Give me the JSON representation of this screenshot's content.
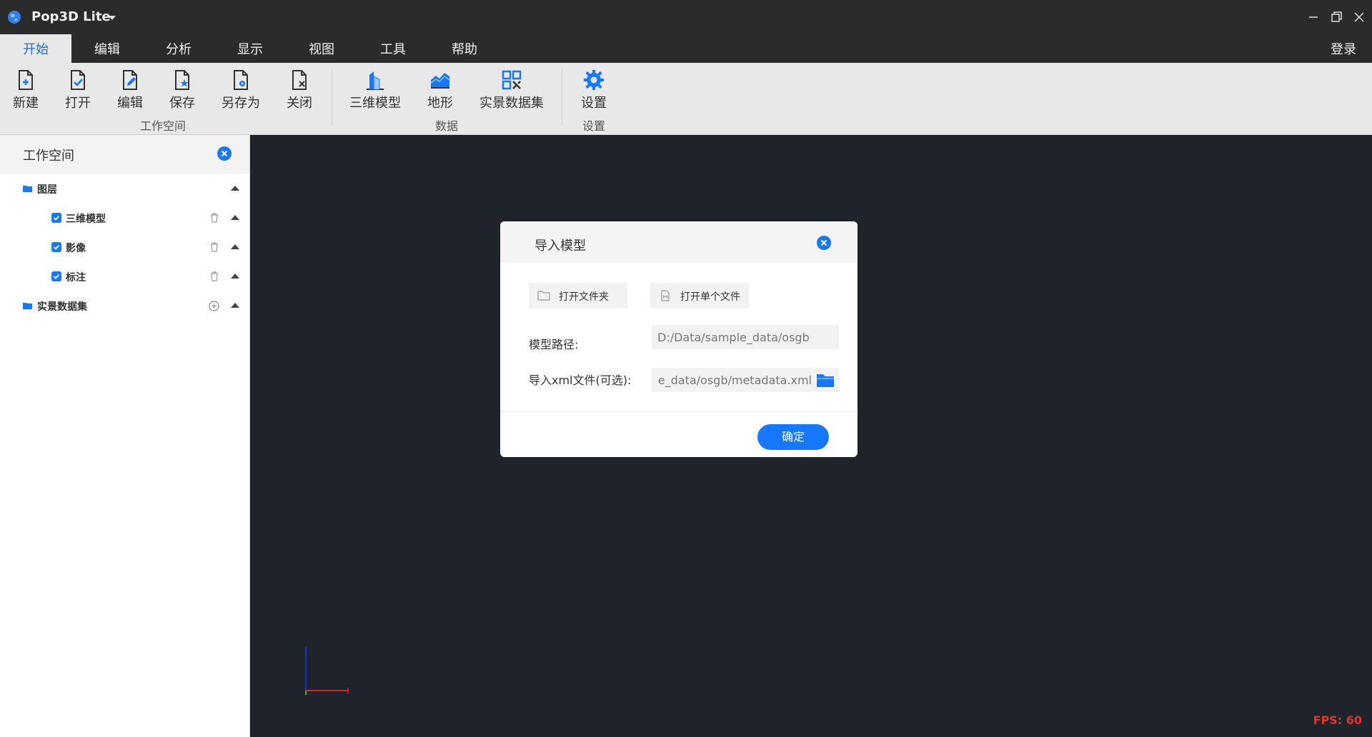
{
  "app": {
    "title": "Pop3D Lite"
  },
  "menu": {
    "tabs": [
      "开始",
      "编辑",
      "分析",
      "显示",
      "视图",
      "工具",
      "帮助"
    ],
    "login": "登录"
  },
  "ribbon": {
    "buttons": [
      {
        "label": "新建",
        "icon": "new-file-icon"
      },
      {
        "label": "打开",
        "icon": "open-file-icon"
      },
      {
        "label": "编辑",
        "icon": "edit-file-icon"
      },
      {
        "label": "保存",
        "icon": "save-file-icon"
      },
      {
        "label": "另存为",
        "icon": "save-as-icon"
      },
      {
        "label": "关闭",
        "icon": "close-file-icon"
      },
      {
        "label": "三维模型",
        "icon": "3d-model-icon"
      },
      {
        "label": "地形",
        "icon": "terrain-icon"
      },
      {
        "label": "实景数据集",
        "icon": "dataset-icon"
      },
      {
        "label": "设置",
        "icon": "gear-icon"
      }
    ],
    "groups": [
      "工作空间",
      "数据",
      "设置"
    ]
  },
  "sidebar": {
    "title": "工作空间",
    "tree": {
      "layers_label": "图层",
      "items": [
        {
          "label": "三维模型",
          "checked": true
        },
        {
          "label": "影像",
          "checked": true
        },
        {
          "label": "标注",
          "checked": true
        }
      ],
      "dataset_label": "实景数据集"
    }
  },
  "viewport": {
    "fps": "FPS: 60"
  },
  "dialog": {
    "title": "导入模型",
    "open_folder": "打开文件夹",
    "open_file": "打开单个文件",
    "path_label": "模型路径:",
    "path_value": "D:/Data/sample_data/osgb",
    "xml_label": "导入xml文件(可选):",
    "xml_value": "D:/Data/sample_data/osgb/metadata.xml",
    "ok": "确定"
  },
  "colors": {
    "accent": "#1677ff",
    "titlebar": "#2b2b2b",
    "ribbon": "#e8e8e8",
    "viewport": "#1f232a",
    "fps": "#e0352b"
  }
}
